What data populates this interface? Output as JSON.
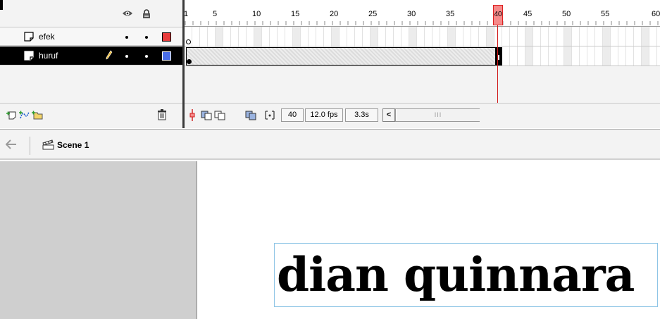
{
  "layers_panel": {
    "header_icons": [
      "eye-icon",
      "lock-icon",
      "outline-icon"
    ],
    "layers": [
      {
        "name": "efek",
        "color": "#e83c3c",
        "selected": false,
        "editing": false
      },
      {
        "name": "huruf",
        "color": "#4a6ee8",
        "selected": true,
        "editing": true
      }
    ],
    "footer_buttons": [
      "insert-layer-icon",
      "add-motion-guide-icon",
      "insert-folder-icon",
      "delete-layer-icon"
    ]
  },
  "ruler": {
    "first": "1",
    "marks": [
      "5",
      "10",
      "15",
      "20",
      "25",
      "30",
      "35",
      "40",
      "45",
      "50",
      "55",
      "60"
    ],
    "current_frame_label": "40"
  },
  "frames": {
    "efek": {
      "keyframe_at": "1",
      "keyframe_type": "empty"
    },
    "huruf": {
      "keyframe_at": "1",
      "tween_end": "40",
      "keyframe_type": "filled"
    }
  },
  "status_bar": {
    "current_frame": "40",
    "frame_rate": "12.0 fps",
    "elapsed_time": "3.3s",
    "scroll_thumb_label": "III",
    "buttons": [
      "center-frame-icon",
      "onion-skin-icon",
      "onion-skin-outlines-icon",
      "edit-multiple-frames-icon",
      "modify-onion-markers-icon"
    ],
    "scroll_left_label": "<"
  },
  "edit_bar": {
    "back_icon": "back-arrow-icon",
    "scene_label": "Scene 1"
  },
  "stage": {
    "text": "dian quinnara",
    "selection_color": "#8ec5e6",
    "pasteboard_color": "#cfcfcf"
  }
}
